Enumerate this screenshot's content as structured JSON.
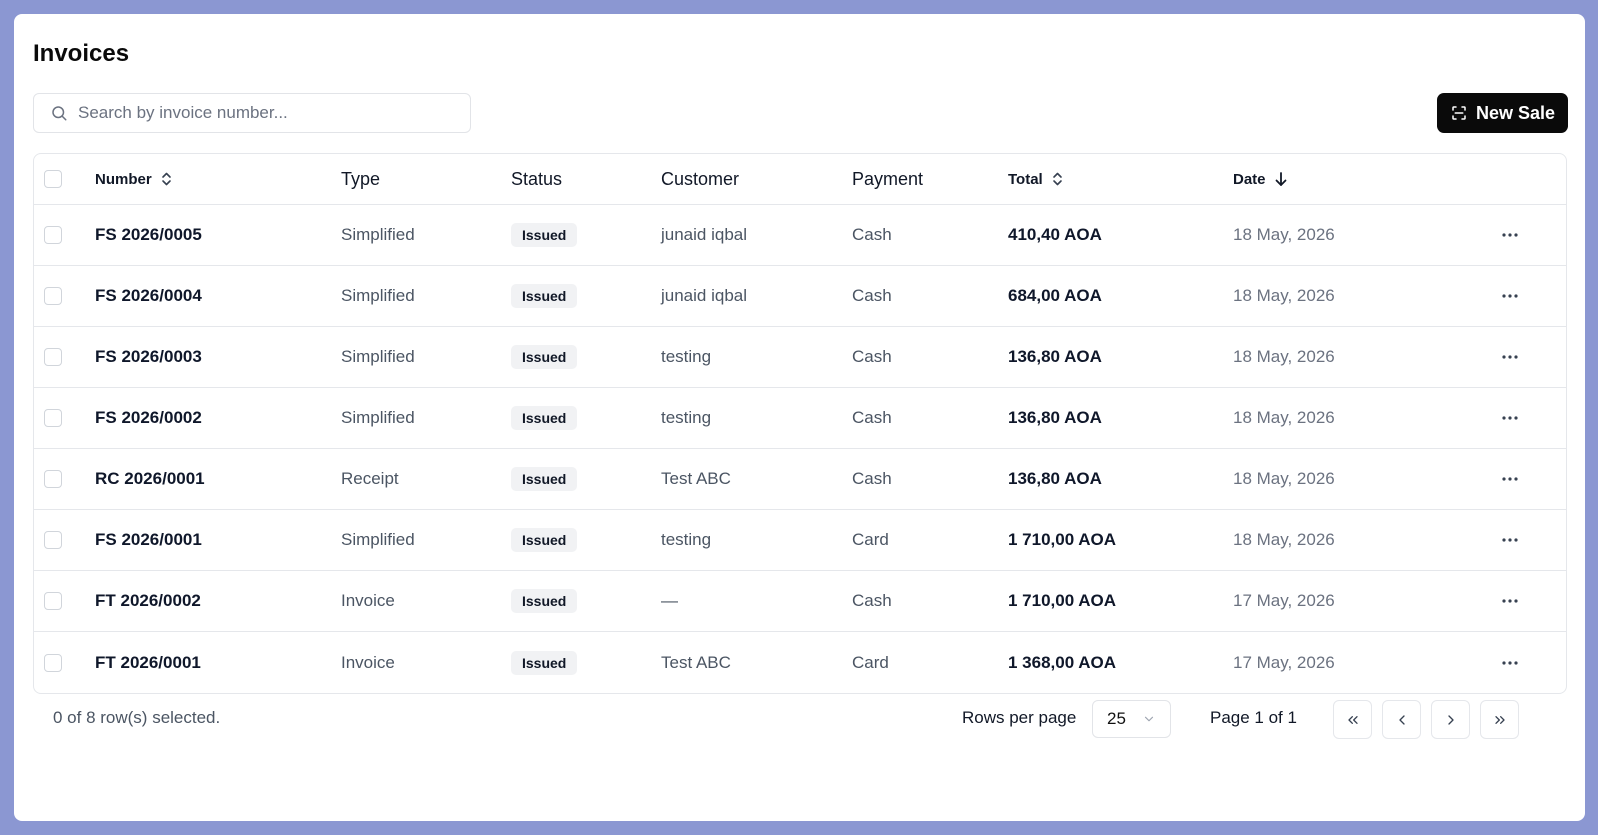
{
  "page": {
    "title": "Invoices"
  },
  "search": {
    "placeholder": "Search by invoice number..."
  },
  "toolbar": {
    "new_sale_label": "New Sale"
  },
  "table": {
    "headers": {
      "number": "Number",
      "type": "Type",
      "status": "Status",
      "customer": "Customer",
      "payment": "Payment",
      "total": "Total",
      "date": "Date"
    },
    "rows": [
      {
        "number": "FS 2026/0005",
        "type": "Simplified",
        "status": "Issued",
        "customer": "junaid iqbal",
        "payment": "Cash",
        "total": "410,40 AOA",
        "date": "18 May, 2026"
      },
      {
        "number": "FS 2026/0004",
        "type": "Simplified",
        "status": "Issued",
        "customer": "junaid iqbal",
        "payment": "Cash",
        "total": "684,00 AOA",
        "date": "18 May, 2026"
      },
      {
        "number": "FS 2026/0003",
        "type": "Simplified",
        "status": "Issued",
        "customer": "testing",
        "payment": "Cash",
        "total": "136,80 AOA",
        "date": "18 May, 2026"
      },
      {
        "number": "FS 2026/0002",
        "type": "Simplified",
        "status": "Issued",
        "customer": "testing",
        "payment": "Cash",
        "total": "136,80 AOA",
        "date": "18 May, 2026"
      },
      {
        "number": "RC 2026/0001",
        "type": "Receipt",
        "status": "Issued",
        "customer": "Test ABC",
        "payment": "Cash",
        "total": "136,80 AOA",
        "date": "18 May, 2026"
      },
      {
        "number": "FS 2026/0001",
        "type": "Simplified",
        "status": "Issued",
        "customer": "testing",
        "payment": "Card",
        "total": "1 710,00 AOA",
        "date": "18 May, 2026"
      },
      {
        "number": "FT 2026/0002",
        "type": "Invoice",
        "status": "Issued",
        "customer": "—",
        "payment": "Cash",
        "total": "1 710,00 AOA",
        "date": "17 May, 2026"
      },
      {
        "number": "FT 2026/0001",
        "type": "Invoice",
        "status": "Issued",
        "customer": "Test ABC",
        "payment": "Card",
        "total": "1 368,00 AOA",
        "date": "17 May, 2026"
      }
    ]
  },
  "footer": {
    "selection_text": "0 of 8 row(s) selected.",
    "rows_per_page_label": "Rows per page",
    "rows_per_page_value": "25",
    "page_text": "Page 1 of 1"
  },
  "icons": {
    "search": "search-icon",
    "scan": "scan-icon",
    "sort": "sort-icon",
    "sort_desc": "arrow-down-icon",
    "more": "more-horizontal-icon",
    "chevron_down": "chevron-down-icon",
    "first": "chevrons-left-icon",
    "prev": "chevron-left-icon",
    "next": "chevron-right-icon",
    "last": "chevrons-right-icon"
  },
  "colors": {
    "background": "#8b97d2",
    "primary_button": "#0a0a0a",
    "badge_bg": "#f1f2f4"
  }
}
